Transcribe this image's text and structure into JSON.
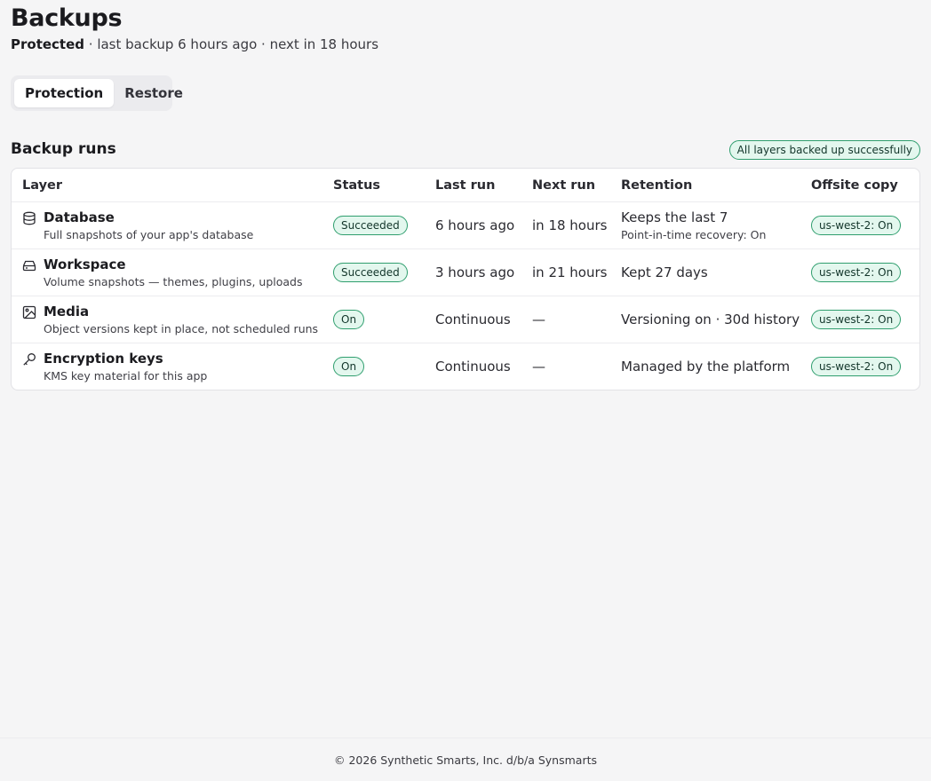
{
  "header": {
    "title": "Backups",
    "status_strong": "Protected",
    "status_rest": " · last backup 6 hours ago · next in 18 hours"
  },
  "tabs": [
    {
      "label": "Protection",
      "active": true
    },
    {
      "label": "Restore",
      "active": false
    }
  ],
  "section": {
    "title": "Backup runs",
    "summary_badge": "All layers backed up successfully"
  },
  "table": {
    "columns": [
      "Layer",
      "Status",
      "Last run",
      "Next run",
      "Retention",
      "Offsite copy"
    ],
    "rows": [
      {
        "icon": "database-icon",
        "name": "Database",
        "description": "Full snapshots of your app's database",
        "status": "Succeeded",
        "last_run": "6 hours ago",
        "next_run": "in 18 hours",
        "retention": "Keeps the last 7",
        "retention_sub": "Point-in-time recovery: On",
        "offsite": "us-west-2: On"
      },
      {
        "icon": "drive-icon",
        "name": "Workspace",
        "description": "Volume snapshots — themes, plugins, uploads",
        "status": "Succeeded",
        "last_run": "3 hours ago",
        "next_run": "in 21 hours",
        "retention": "Kept 27 days",
        "retention_sub": "",
        "offsite": "us-west-2: On"
      },
      {
        "icon": "image-icon",
        "name": "Media",
        "description": "Object versions kept in place, not scheduled runs",
        "status": "On",
        "last_run": "Continuous",
        "next_run": "—",
        "retention": "Versioning on · 30d history",
        "retention_sub": "",
        "offsite": "us-west-2: On"
      },
      {
        "icon": "key-icon",
        "name": "Encryption keys",
        "description": "KMS key material for this app",
        "status": "On",
        "last_run": "Continuous",
        "next_run": "—",
        "retention": "Managed by the platform",
        "retention_sub": "",
        "offsite": "us-west-2: On"
      }
    ]
  },
  "footer": {
    "text": "© 2026 Synthetic Smarts, Inc. d/b/a Synsmarts"
  },
  "colors": {
    "background": "#f5f5f6",
    "badge_border": "#2f9e6e",
    "badge_fill": "#e3f7ee"
  }
}
